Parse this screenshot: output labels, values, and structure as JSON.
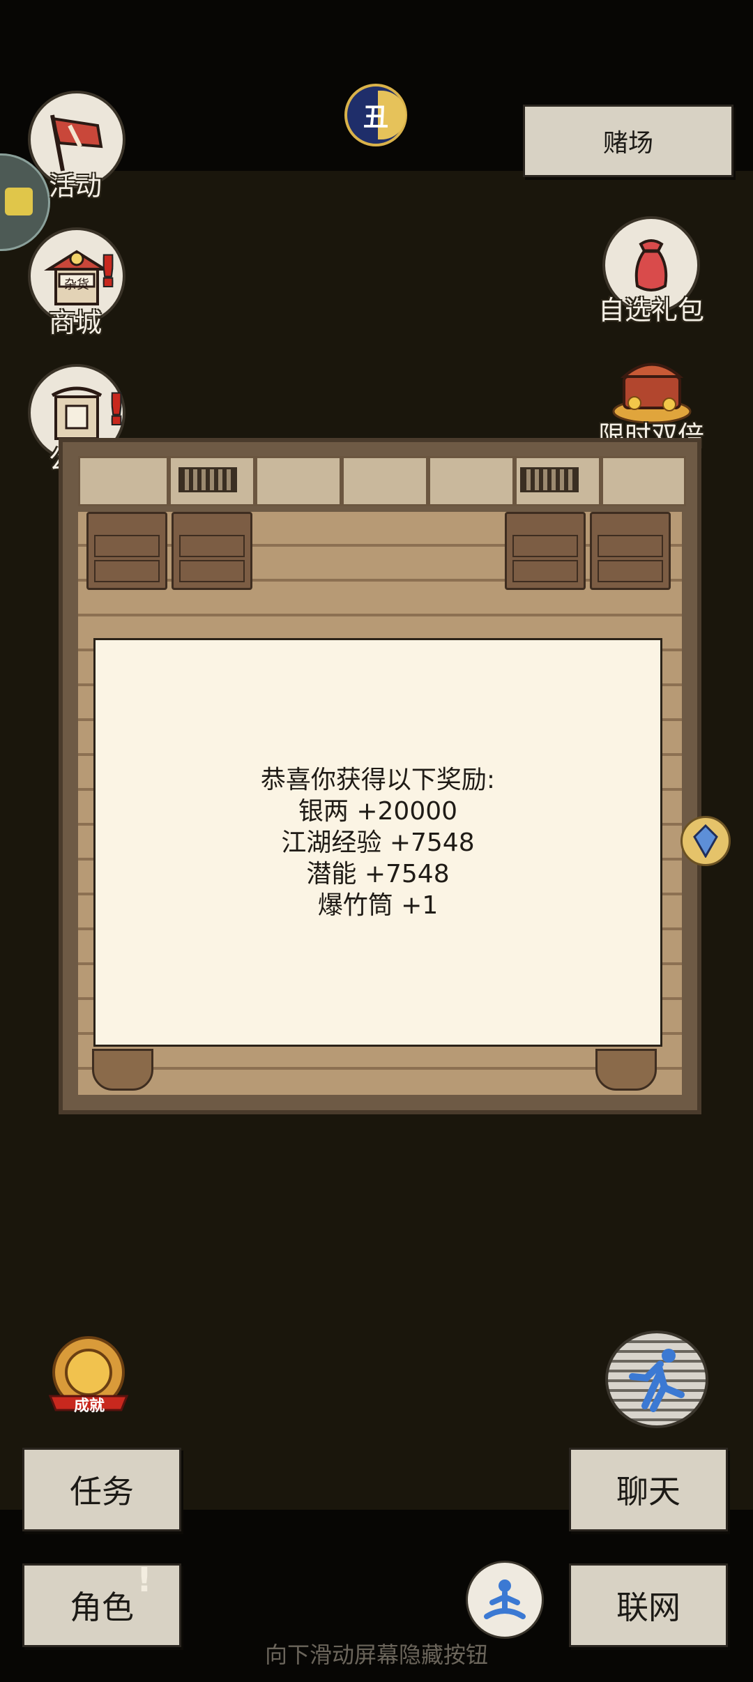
{
  "top": {
    "casino_label": "赌场",
    "time_badge": "丑"
  },
  "left_icons": {
    "events": {
      "label": "活动",
      "icon": "banner-sword-icon"
    },
    "shop": {
      "label": "商城",
      "icon": "shop-stall-icon",
      "sign": "杂货"
    },
    "notice": {
      "label": "公告",
      "icon": "notice-board-icon"
    }
  },
  "right_icons": {
    "gift_pack": {
      "label": "自选礼包",
      "icon": "gift-bag-icon"
    },
    "double_time": {
      "label": "限时双倍",
      "icon": "treasure-chest-icon"
    }
  },
  "reward_dialog": {
    "title": "恭喜你获得以下奖励:",
    "rewards": [
      "银两 +20000",
      "江湖经验 +7548",
      "潜能 +7548",
      "爆竹筒 +1"
    ]
  },
  "achievement": {
    "label": "成就"
  },
  "buttons": {
    "tasks": "任务",
    "chat": "聊天",
    "character": "角色",
    "network": "联网"
  },
  "hint": "向下滑动屏幕隐藏按钮",
  "colors": {
    "background": "#070604",
    "paper": "#d8d2c4",
    "dialog": "#fbf4e4",
    "alert": "#c8281e"
  }
}
